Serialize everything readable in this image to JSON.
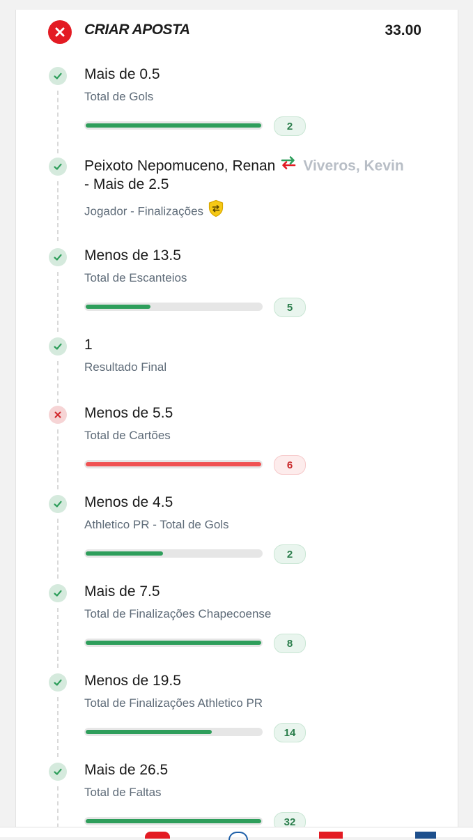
{
  "header": {
    "title": "CRIAR APOSTA",
    "odds": "33.00",
    "status": "lost"
  },
  "legs": [
    {
      "title": "Mais de 0.5",
      "subtitle": "Total de Gols",
      "status": "won",
      "progress": 1.0,
      "value": "2"
    },
    {
      "title_main": "Peixoto Nepomuceno, Renan",
      "title_alt": "Viveros, Kevin",
      "title_line2": "- Mais de 2.5",
      "subtitle": "Jogador - Finalizações",
      "status": "won",
      "icon": "player-swap-icon",
      "badge": "shield-swap-icon"
    },
    {
      "title": "Menos de 13.5",
      "subtitle": "Total de Escanteios",
      "status": "won",
      "progress": 0.37,
      "value": "5"
    },
    {
      "title": "1",
      "subtitle": "Resultado Final",
      "status": "won"
    },
    {
      "title": "Menos de 5.5",
      "subtitle": "Total de Cartões",
      "status": "lost",
      "progress": 1.0,
      "value": "6"
    },
    {
      "title": "Menos de 4.5",
      "subtitle": "Athletico PR - Total de Gols",
      "status": "won",
      "progress": 0.44,
      "value": "2"
    },
    {
      "title": "Mais de 7.5",
      "subtitle": "Total de Finalizações Chapecoense",
      "status": "won",
      "progress": 1.0,
      "value": "8"
    },
    {
      "title": "Menos de 19.5",
      "subtitle": "Total de Finalizações Athletico PR",
      "status": "won",
      "progress": 0.72,
      "value": "14"
    },
    {
      "title": "Mais de 26.5",
      "subtitle": "Total de Faltas",
      "status": "won",
      "progress": 1.0,
      "value": "32"
    }
  ],
  "colors": {
    "won": "#2e9e5b",
    "lost": "#e31b23",
    "lost_bar": "#f05253"
  }
}
